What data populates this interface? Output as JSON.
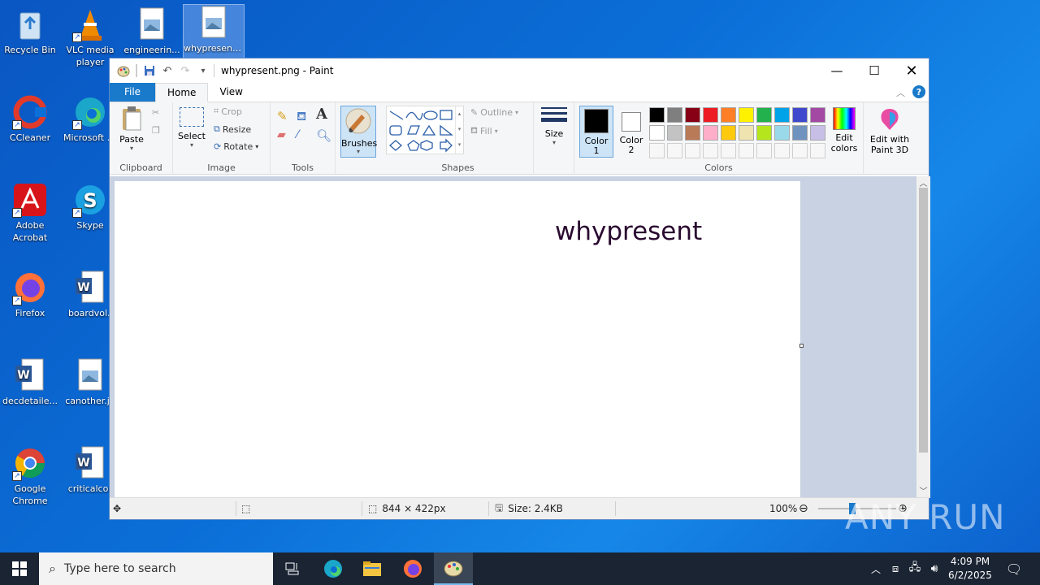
{
  "desktop": {
    "icons": [
      {
        "label": "Recycle Bin"
      },
      {
        "label": "VLC media player"
      },
      {
        "label": "engineerin..."
      },
      {
        "label": "whypresent..."
      },
      {
        "label": "CCleaner"
      },
      {
        "label": "Microsoft Edge"
      },
      {
        "label": "Adobe Acrobat"
      },
      {
        "label": "Skype"
      },
      {
        "label": "Firefox"
      },
      {
        "label": "boardvol.r"
      },
      {
        "label": "decdetaile..."
      },
      {
        "label": "canother.jp"
      },
      {
        "label": "Google Chrome"
      },
      {
        "label": "criticalcon"
      }
    ]
  },
  "paint": {
    "title": "whypresent.png - Paint",
    "tabs": {
      "file": "File",
      "home": "Home",
      "view": "View"
    },
    "clipboard": {
      "paste": "Paste",
      "group": "Clipboard"
    },
    "image": {
      "select": "Select",
      "crop": "Crop",
      "resize": "Resize",
      "rotate": "Rotate",
      "group": "Image"
    },
    "tools": {
      "group": "Tools"
    },
    "brushes": "Brushes",
    "shapes": {
      "outline": "Outline",
      "fill": "Fill",
      "group": "Shapes"
    },
    "size": "Size",
    "colors": {
      "color1": "Color",
      "color1_num": "1",
      "color2": "Color",
      "color2_num": "2",
      "edit_colors": "Edit colors",
      "paint3d": "Edit with Paint 3D",
      "group": "Colors",
      "palette_row1": [
        "#000000",
        "#7f7f7f",
        "#880015",
        "#ed1c24",
        "#ff7f27",
        "#fff200",
        "#22b14c",
        "#00a2e8",
        "#3f48cc",
        "#a349a4"
      ],
      "palette_row2": [
        "#ffffff",
        "#c3c3c3",
        "#b97a57",
        "#ffaec9",
        "#ffc90e",
        "#efe4b0",
        "#b5e61d",
        "#99d9ea",
        "#7092be",
        "#c8bfe7"
      ]
    },
    "canvas_text": "whypresent",
    "status": {
      "dimensions": "844 × 422px",
      "size": "Size: 2.4KB",
      "zoom": "100%"
    }
  },
  "taskbar": {
    "search_placeholder": "Type here to search",
    "time": "4:09 PM",
    "date": "6/2/2025"
  },
  "watermark": "ANY RUN"
}
